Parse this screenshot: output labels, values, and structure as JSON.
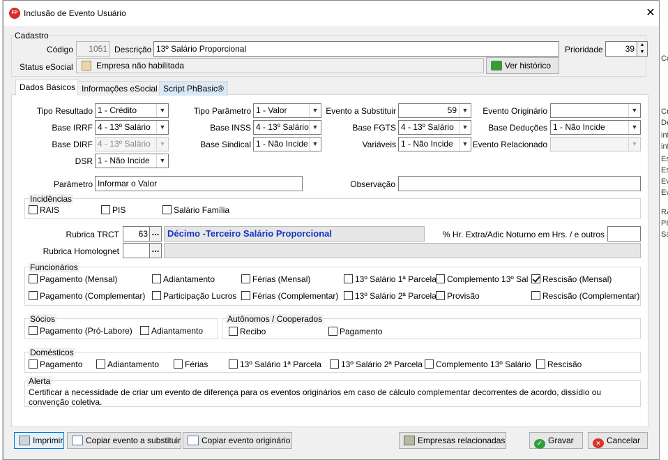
{
  "window": {
    "title": "Inclusão de Evento Usuário",
    "icon_text": "FP"
  },
  "background_letters": [
    "Có",
    "Cr",
    "Dé",
    "inf",
    "inf",
    "Es",
    "Es",
    "Ev",
    "Ev",
    "RA",
    "PI",
    "Sa"
  ],
  "cadastro": {
    "group_title": "Cadastro",
    "codigo_label": "Código",
    "codigo_value": "1051",
    "descricao_label": "Descrição",
    "descricao_value": "13º Salário Proporcional",
    "prioridade_label": "Prioridade",
    "prioridade_value": "39",
    "status_label": "Status eSocial",
    "status_value": "Empresa não habilitada",
    "historico_button": "Ver histórico"
  },
  "tabs": [
    "Dados Básicos",
    "Informações eSocial",
    "Script PhBasic®"
  ],
  "dados": {
    "tipo_resultado_label": "Tipo Resultado",
    "tipo_resultado": "1 - Crédito",
    "tipo_parametro_label": "Tipo Parâmetro",
    "tipo_parametro": "1 - Valor",
    "evento_substituir_label": "Evento a Substituir",
    "evento_substituir": "59",
    "evento_originario_label": "Evento Originário",
    "evento_originario": "",
    "base_irrf_label": "Base IRRF",
    "base_irrf": "4 - 13º Salário",
    "base_inss_label": "Base INSS",
    "base_inss": "4 - 13º Salário",
    "base_fgts_label": "Base FGTS",
    "base_fgts": "4 - 13º Salário",
    "base_deducoes_label": "Base Deduções",
    "base_deducoes": "1 - Não Incide",
    "base_dirf_label": "Base DIRF",
    "base_dirf": "4 - 13º Salário",
    "base_sindical_label": "Base Sindical",
    "base_sindical": "1 - Não Incide",
    "variaveis_label": "Variáveis",
    "variaveis": "1 - Não Incide",
    "evento_relacionado_label": "Evento Relacionado",
    "evento_relacionado": "",
    "dsr_label": "DSR",
    "dsr": "1 - Não Incide",
    "parametro_label": "Parâmetro",
    "parametro": "Informar o Valor",
    "observacao_label": "Observação",
    "observacao": ""
  },
  "incidencias": {
    "title": "Incidências",
    "items": [
      {
        "label": "RAIS",
        "checked": false
      },
      {
        "label": "PIS",
        "checked": false
      },
      {
        "label": "Salário Família",
        "checked": false
      }
    ]
  },
  "rubrica": {
    "trct_label": "Rubrica TRCT",
    "trct_code": "63",
    "trct_desc": "Décimo -Terceiro Salário Proporcional",
    "hr_extra_label": "% Hr. Extra/Adic Noturno em Hrs. / e outros",
    "hr_extra_value": "",
    "homolog_label": "Rubrica Homolognet",
    "homolog_code": "",
    "homolog_desc": "",
    "ellipsis": "..."
  },
  "funcionarios": {
    "title": "Funcionários",
    "items": [
      {
        "label": "Pagamento (Mensal)",
        "checked": false
      },
      {
        "label": "Adiantamento",
        "checked": false
      },
      {
        "label": "Férias (Mensal)",
        "checked": false
      },
      {
        "label": "13º Salário 1ª Parcela",
        "checked": false
      },
      {
        "label": "Complemento 13º Sal",
        "checked": false
      },
      {
        "label": "Rescisão (Mensal)",
        "checked": true
      },
      {
        "label": "Pagamento (Complementar)",
        "checked": false
      },
      {
        "label": "Participação Lucros",
        "checked": false
      },
      {
        "label": "Férias (Complementar)",
        "checked": false
      },
      {
        "label": "13º Salário 2ª Parcela",
        "checked": false
      },
      {
        "label": "Provisão",
        "checked": false
      },
      {
        "label": "Rescisão (Complementar)",
        "checked": false
      }
    ]
  },
  "socios": {
    "title": "Sócios",
    "items": [
      {
        "label": "Pagamento (Pró-Labore)",
        "checked": false
      },
      {
        "label": "Adiantamento",
        "checked": false
      }
    ]
  },
  "autonomos": {
    "title": "Autônomos / Cooperados",
    "items": [
      {
        "label": "Recibo",
        "checked": false
      },
      {
        "label": "Pagamento",
        "checked": false
      }
    ]
  },
  "domesticos": {
    "title": "Domésticos",
    "items": [
      {
        "label": "Pagamento",
        "checked": false
      },
      {
        "label": "Adiantamento",
        "checked": false
      },
      {
        "label": "Férias",
        "checked": false
      },
      {
        "label": "13º Salário 1ª Parcela",
        "checked": false
      },
      {
        "label": "13º Salário 2ª Parcela",
        "checked": false
      },
      {
        "label": "Complemento 13º Salário",
        "checked": false
      },
      {
        "label": "Rescisão",
        "checked": false
      }
    ]
  },
  "alerta": {
    "title": "Alerta",
    "text": "Certificar a necessidade de criar um evento de diferença para os eventos originários em caso de cálculo complementar decorrentes de acordo, dissídio ou convenção coletiva."
  },
  "footer": {
    "imprimir": "Imprimir",
    "copiar_substituir": "Copiar evento a substituir",
    "copiar_originario": "Copiar evento originário",
    "empresas": "Empresas relacionadas",
    "gravar": "Gravar",
    "cancelar": "Cancelar"
  }
}
